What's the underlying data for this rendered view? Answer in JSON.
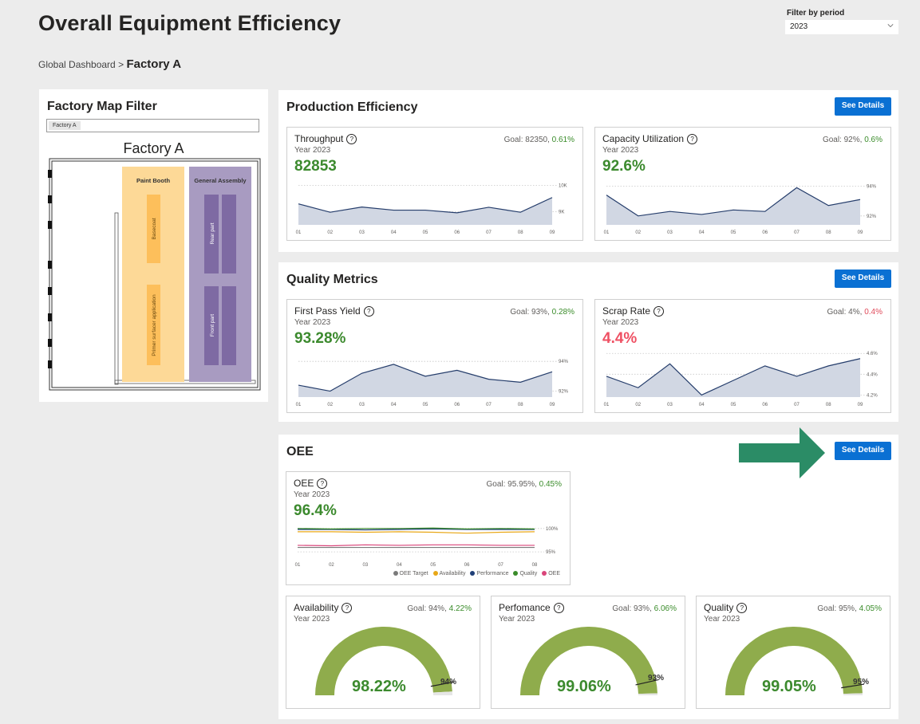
{
  "header": {
    "title": "Overall Equipment Efficiency",
    "filter_label": "Filter by period",
    "filter_value": "2023"
  },
  "breadcrumb": {
    "root": "Global Dashboard",
    "separator": ">",
    "current": "Factory A"
  },
  "map": {
    "title": "Factory Map Filter",
    "chip": "Factory A",
    "factory_name": "Factory A",
    "paint_booth": "Paint Booth",
    "general_assembly": "General Assembly",
    "basecoat": "Basecoat",
    "primer": "Primer surfacer application",
    "rear_part": "Rear part",
    "front_part": "Front part"
  },
  "production": {
    "title": "Production Efficiency",
    "button": "See Details",
    "throughput": {
      "title": "Throughput",
      "sub": "Year 2023",
      "goal": "Goal: 82350,",
      "delta": "0.61%",
      "value": "82853"
    },
    "capacity": {
      "title": "Capacity Utilization",
      "sub": "Year 2023",
      "goal": "Goal: 92%,",
      "delta": "0.6%",
      "value": "92.6%"
    }
  },
  "quality_metrics": {
    "title": "Quality Metrics",
    "button": "See Details",
    "fpy": {
      "title": "First Pass Yield",
      "sub": "Year 2023",
      "goal": "Goal: 93%,",
      "delta": "0.28%",
      "value": "93.28%"
    },
    "scrap": {
      "title": "Scrap Rate",
      "sub": "Year 2023",
      "goal": "Goal: 4%,",
      "delta": "0.4%",
      "value": "4.4%"
    }
  },
  "oee": {
    "title": "OEE",
    "button": "See Details",
    "card": {
      "title": "OEE",
      "sub": "Year 2023",
      "goal": "Goal: 95.95%,",
      "delta": "0.45%",
      "value": "96.4%"
    },
    "legend": [
      "OEE Target",
      "Availability",
      "Performance",
      "Quality",
      "OEE"
    ],
    "legend_colors": [
      "#7a7a7a",
      "#e8a717",
      "#1f3f77",
      "#3a8c2a",
      "#d9457a"
    ],
    "availability": {
      "title": "Availability",
      "sub": "Year 2023",
      "goal": "Goal: 94%,",
      "delta": "4.22%",
      "value": "98.22%",
      "target": "94%"
    },
    "performance": {
      "title": "Perfomance",
      "sub": "Year 2023",
      "goal": "Goal: 93%,",
      "delta": "6.06%",
      "value": "99.06%",
      "target": "93%"
    },
    "quality": {
      "title": "Quality",
      "sub": "Year 2023",
      "goal": "Goal: 95%,",
      "delta": "4.05%",
      "value": "99.05%",
      "target": "95%"
    }
  },
  "colors": {
    "accent": "#0a70d3",
    "good": "#3a8c2a",
    "bad": "#ef5063",
    "gauge": "#8fac4c",
    "area": "#d1d7e3",
    "line": "#253d6b",
    "arrow": "#2b8c66",
    "paint_booth": "#fdd997",
    "general_assembly": "#a89bc1"
  },
  "chart_data": [
    {
      "type": "area",
      "x": [
        "01",
        "02",
        "03",
        "04",
        "05",
        "06",
        "07",
        "08",
        "09"
      ],
      "values": [
        9300,
        8980,
        9180,
        9060,
        9060,
        8960,
        9170,
        8980,
        9540
      ],
      "yticks": [
        "10K",
        "9K"
      ],
      "ylim": [
        8500,
        10200
      ]
    },
    {
      "type": "area",
      "x": [
        "01",
        "02",
        "03",
        "04",
        "05",
        "06",
        "07",
        "08",
        "09"
      ],
      "values": [
        93.4,
        92.0,
        92.3,
        92.1,
        92.4,
        92.3,
        93.9,
        92.7,
        93.1
      ],
      "yticks": [
        "94%",
        "92%"
      ],
      "ylim": [
        91.4,
        94.4
      ]
    },
    {
      "type": "area",
      "x": [
        "01",
        "02",
        "03",
        "04",
        "05",
        "06",
        "07",
        "08",
        "09"
      ],
      "values": [
        92.4,
        92.0,
        93.2,
        93.8,
        93.0,
        93.4,
        92.8,
        92.6,
        93.3
      ],
      "yticks": [
        "94%",
        "92%"
      ],
      "ylim": [
        91.6,
        94.6
      ]
    },
    {
      "type": "area",
      "x": [
        "01",
        "02",
        "03",
        "04",
        "05",
        "06",
        "07",
        "08",
        "09"
      ],
      "values": [
        4.38,
        4.27,
        4.5,
        4.2,
        4.34,
        4.48,
        4.38,
        4.48,
        4.55
      ],
      "yticks": [
        "4.6%",
        "4.4%",
        "4.2%"
      ],
      "ylim": [
        4.18,
        4.64
      ]
    },
    {
      "type": "line",
      "x": [
        "01",
        "02",
        "03",
        "04",
        "05",
        "06",
        "07",
        "08"
      ],
      "yticks": [
        "100%",
        "95%"
      ],
      "ylim": [
        94.0,
        101.5
      ],
      "series": [
        {
          "name": "OEE Target",
          "values": [
            95.95,
            95.95,
            95.95,
            95.95,
            95.95,
            95.95,
            95.95,
            95.95
          ]
        },
        {
          "name": "Availability",
          "values": [
            99.3,
            99.3,
            99.2,
            99.3,
            99.2,
            99.0,
            99.2,
            99.3
          ]
        },
        {
          "name": "Performance",
          "values": [
            99.8,
            99.8,
            99.7,
            99.8,
            99.9,
            99.8,
            99.8,
            99.8
          ]
        },
        {
          "name": "Quality",
          "values": [
            100.0,
            99.9,
            100.0,
            100.0,
            100.1,
            99.9,
            100.0,
            99.9
          ]
        },
        {
          "name": "OEE",
          "values": [
            96.4,
            96.3,
            96.5,
            96.4,
            96.5,
            96.5,
            96.4,
            96.4
          ]
        }
      ]
    },
    {
      "type": "gauge",
      "name": "Availability",
      "value": 98.22,
      "target": 94,
      "max": 100
    },
    {
      "type": "gauge",
      "name": "Perfomance",
      "value": 99.06,
      "target": 93,
      "max": 100
    },
    {
      "type": "gauge",
      "name": "Quality",
      "value": 99.05,
      "target": 95,
      "max": 100
    }
  ]
}
